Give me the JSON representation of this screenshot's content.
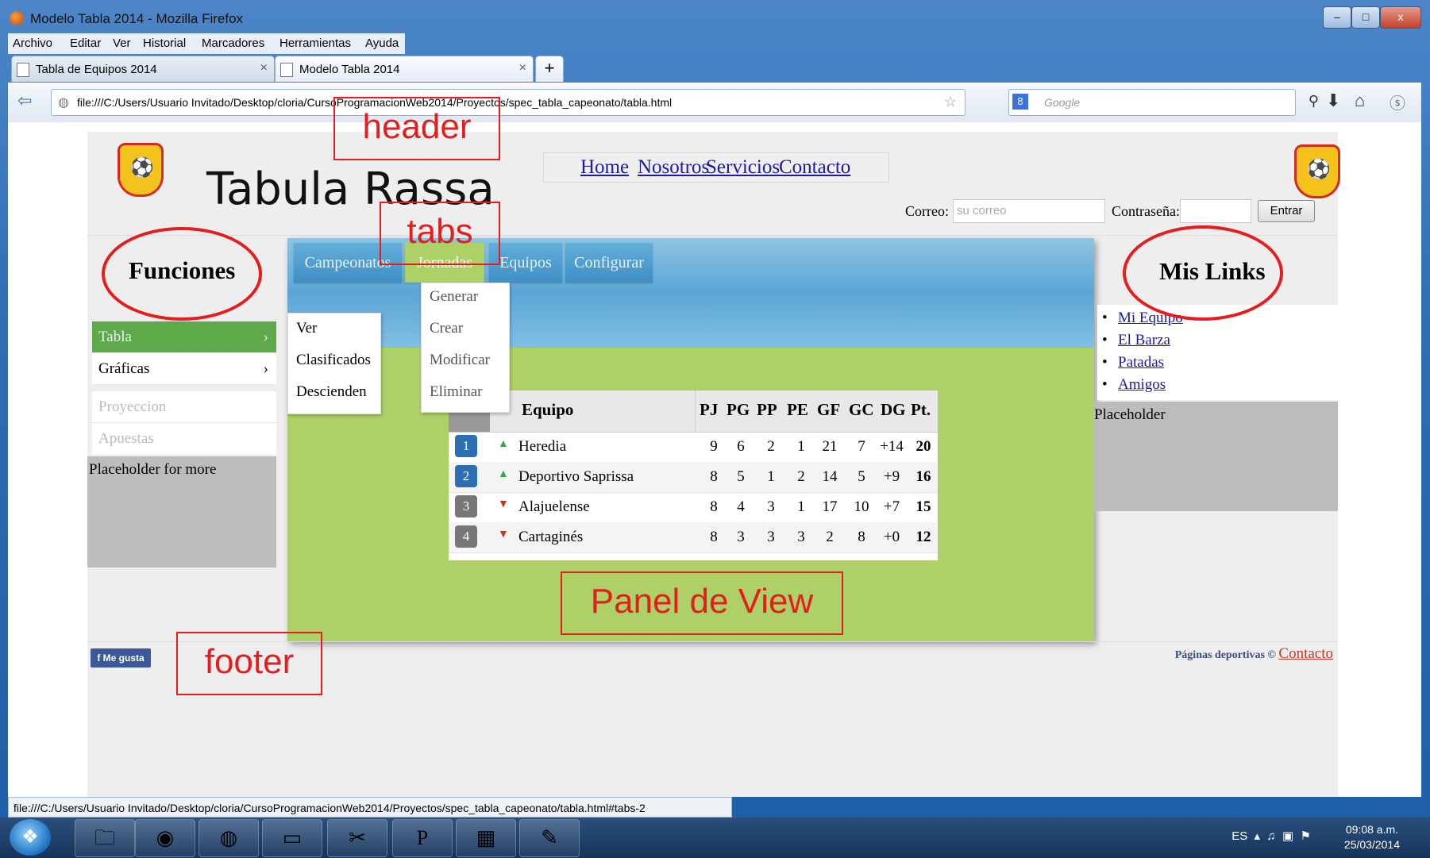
{
  "window": {
    "title": "Modelo Tabla 2014 - Mozilla Firefox",
    "min": "–",
    "max": "□",
    "close": "x"
  },
  "menubar": [
    "Archivo",
    "Editar",
    "Ver",
    "Historial",
    "Marcadores",
    "Herramientas",
    "Ayuda"
  ],
  "browser_tabs": [
    {
      "label": "Tabla de Equipos 2014",
      "close": "×"
    },
    {
      "label": "Modelo Tabla 2014",
      "close": "×"
    }
  ],
  "new_tab": "+",
  "url": "file:///C:/Users/Usuario Invitado/Desktop/cloria/CursoProgramacionWeb2014/Proyectos/spec_tabla_capeonato/tabla.html",
  "search": {
    "placeholder": "Google"
  },
  "page": {
    "brand": "Tabula Rassa",
    "nav": [
      "Home",
      "Nosotros",
      "Servicios",
      "Contacto"
    ],
    "login": {
      "email_label": "Correo:",
      "email_placeholder": "su correo",
      "pass_label": "Contraseña:",
      "submit": "Entrar"
    },
    "left": {
      "title": "Funciones",
      "menu": [
        {
          "label": "Tabla",
          "arrow": "›"
        },
        {
          "label": "Gráficas",
          "arrow": "›"
        },
        {
          "label": "Proyeccion",
          "arrow": ""
        },
        {
          "label": "Apuestas",
          "arrow": ""
        }
      ],
      "submenu": [
        "Ver",
        "Clasificados",
        "Descienden"
      ],
      "placeholder": "Placeholder for more"
    },
    "tabs": [
      "Campeonatos",
      "Jornadas",
      "Equipos",
      "Configurar"
    ],
    "tab_dropdown": [
      "Generar",
      "Crear",
      "Modificar",
      "Eliminar"
    ],
    "table": {
      "headers": [
        "Equipo",
        "PJ",
        "PG",
        "PP",
        "PE",
        "GF",
        "GC",
        "DG",
        "Pt."
      ],
      "rows": [
        {
          "pos": "1",
          "trend": "up",
          "team": "Heredia",
          "pj": "9",
          "pg": "6",
          "pp": "2",
          "pe": "1",
          "gf": "21",
          "gc": "7",
          "dg": "+14",
          "pt": "20"
        },
        {
          "pos": "2",
          "trend": "up",
          "team": "Deportivo Saprissa",
          "pj": "8",
          "pg": "5",
          "pp": "1",
          "pe": "2",
          "gf": "14",
          "gc": "5",
          "dg": "+9",
          "pt": "16"
        },
        {
          "pos": "3",
          "trend": "down",
          "team": "Alajuelense",
          "pj": "8",
          "pg": "4",
          "pp": "3",
          "pe": "1",
          "gf": "17",
          "gc": "10",
          "dg": "+7",
          "pt": "15"
        },
        {
          "pos": "4",
          "trend": "down",
          "team": "Cartaginés",
          "pj": "8",
          "pg": "3",
          "pp": "3",
          "pe": "3",
          "gf": "2",
          "gc": "8",
          "dg": "+0",
          "pt": "12"
        }
      ]
    },
    "right": {
      "title": "Mis Links",
      "links": [
        "Mi Equipo",
        "El Barza",
        "Patadas",
        "Amigos"
      ],
      "placeholder": "Placeholder"
    },
    "footer": {
      "like": "Me gusta",
      "credit": "Páginas deportivas ©",
      "contact": "Contacto"
    }
  },
  "annotations": {
    "header": "header",
    "tabs": "tabs",
    "panel": "Panel de View",
    "footer": "footer"
  },
  "statusbar": "file:///C:/Users/Usuario Invitado/Desktop/cloria/CursoProgramacionWeb2014/Proyectos/spec_tabla_capeonato/tabla.html#tabs-2",
  "taskbar": {
    "lang": "ES",
    "time": "09:08 a.m.",
    "date": "25/03/2014"
  },
  "colors": {
    "accent_green": "#add167",
    "tab_blue": "#3f8fc5",
    "annotation_red": "#e41e1e",
    "pos_blue": "#2c6fb3",
    "pos_gray": "#777777",
    "up_green": "#3aa34a",
    "down_red": "#d32b1e"
  }
}
